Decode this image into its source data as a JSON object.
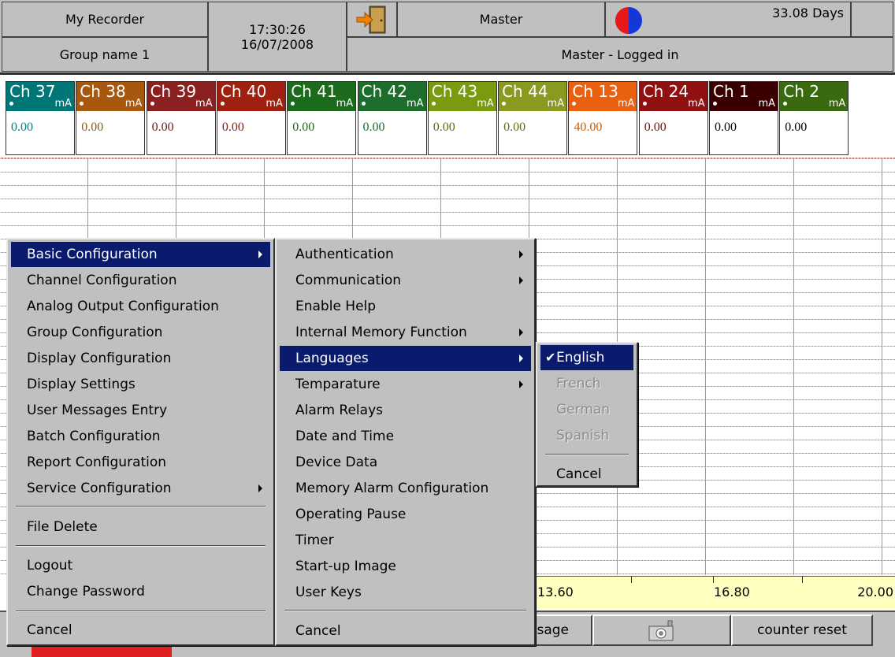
{
  "header": {
    "recorder_name": "My Recorder",
    "group_name": "Group name 1",
    "time": "17:30:26",
    "date": "16/07/2008",
    "user": "Master",
    "user_status": "Master - Logged in",
    "days": "33.08 Days"
  },
  "channels": [
    {
      "name": "Ch 37",
      "unit": "mA",
      "value": "0.00",
      "color": "#007777",
      "value_color": "#008080"
    },
    {
      "name": "Ch 38",
      "unit": "mA",
      "value": "0.00",
      "color": "#a8580e",
      "value_color": "#8a5a10"
    },
    {
      "name": "Ch 39",
      "unit": "mA",
      "value": "0.00",
      "color": "#8a2020",
      "value_color": "#6a2020"
    },
    {
      "name": "Ch 40",
      "unit": "mA",
      "value": "0.00",
      "color": "#a02010",
      "value_color": "#802010"
    },
    {
      "name": "Ch 41",
      "unit": "mA",
      "value": "0.00",
      "color": "#1c6a1c",
      "value_color": "#1c6a1c"
    },
    {
      "name": "Ch 42",
      "unit": "mA",
      "value": "0.00",
      "color": "#1d6e2d",
      "value_color": "#1d6e2d"
    },
    {
      "name": "Ch 43",
      "unit": "mA",
      "value": "0.00",
      "color": "#7a9a10",
      "value_color": "#587010"
    },
    {
      "name": "Ch 44",
      "unit": "mA",
      "value": "0.00",
      "color": "#8a9a20",
      "value_color": "#587010"
    },
    {
      "name": "Ch 13",
      "unit": "mA",
      "value": "40.00",
      "color": "#e86010",
      "value_color": "#c06010"
    },
    {
      "name": "Ch 24",
      "unit": "mA",
      "value": "0.00",
      "color": "#901010",
      "value_color": "#701010"
    },
    {
      "name": "Ch 1",
      "unit": "mA",
      "value": "0.00",
      "color": "#3a0000",
      "value_color": "#000000"
    },
    {
      "name": "Ch 2",
      "unit": "mA",
      "value": "0.00",
      "color": "#3a6a10",
      "value_color": "#000000"
    }
  ],
  "axis": {
    "labels": [
      "13.60",
      "16.80",
      "20.00"
    ]
  },
  "bottom_buttons": {
    "message": "ssage",
    "counter_reset": "counter reset"
  },
  "main_menu": {
    "items": [
      {
        "label": "Basic Configuration",
        "submenu": true,
        "highlighted": true
      },
      {
        "label": "Channel Configuration"
      },
      {
        "label": "Analog Output Configuration"
      },
      {
        "label": "Group Configuration"
      },
      {
        "label": "Display Configuration"
      },
      {
        "label": "Display Settings"
      },
      {
        "label": "User Messages Entry"
      },
      {
        "label": "Batch Configuration"
      },
      {
        "label": "Report Configuration"
      },
      {
        "label": "Service Configuration",
        "submenu": true
      },
      {
        "label": "File Delete"
      },
      {
        "label": "Logout"
      },
      {
        "label": "Change Password"
      },
      {
        "label": "Cancel"
      }
    ]
  },
  "basic_menu": {
    "items": [
      {
        "label": "Authentication",
        "submenu": true
      },
      {
        "label": "Communication",
        "submenu": true
      },
      {
        "label": "Enable Help"
      },
      {
        "label": "Internal Memory Function",
        "submenu": true
      },
      {
        "label": "Languages",
        "submenu": true,
        "highlighted": true
      },
      {
        "label": "Temparature",
        "submenu": true
      },
      {
        "label": "Alarm Relays"
      },
      {
        "label": "Date and Time"
      },
      {
        "label": "Device Data"
      },
      {
        "label": "Memory Alarm Configuration"
      },
      {
        "label": "Operating Pause"
      },
      {
        "label": "Timer"
      },
      {
        "label": "Start-up Image"
      },
      {
        "label": "User Keys"
      },
      {
        "label": "Cancel"
      }
    ]
  },
  "language_menu": {
    "items": [
      {
        "label": "English",
        "checked": true,
        "highlighted": true
      },
      {
        "label": "French",
        "disabled": true
      },
      {
        "label": "German",
        "disabled": true
      },
      {
        "label": "Spanish",
        "disabled": true
      },
      {
        "label": "Cancel"
      }
    ]
  },
  "colors": {
    "menu_highlight": "#0a1b6e",
    "axis_bg": "#ffffc0",
    "menu_bg": "#c0c0c0"
  }
}
